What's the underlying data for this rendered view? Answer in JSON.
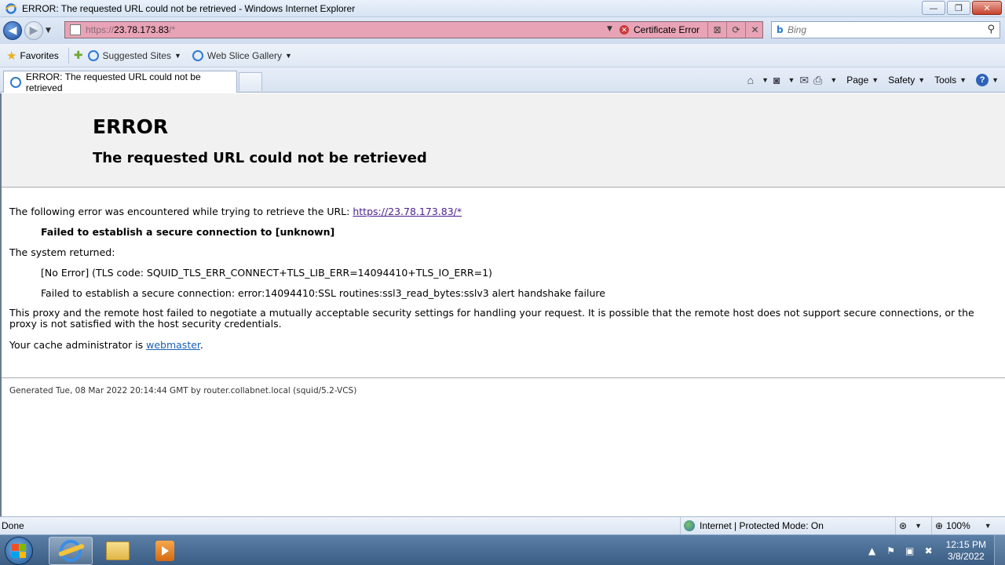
{
  "window": {
    "title": "ERROR: The requested URL could not be retrieved - Windows Internet Explorer",
    "controls": {
      "minimize": "—",
      "maximize": "❐",
      "close": "✕"
    }
  },
  "address": {
    "scheme": "https://",
    "host": "23.78.173.83",
    "path": "/*",
    "certificate_error": "Certificate Error",
    "color": "#e8a4b6"
  },
  "search": {
    "placeholder": "Bing"
  },
  "favorites_bar": {
    "favorites_label": "Favorites",
    "items": [
      {
        "label": "Suggested Sites"
      },
      {
        "label": "Web Slice Gallery"
      }
    ]
  },
  "tab": {
    "title": "ERROR: The requested URL could not be retrieved"
  },
  "command_bar": {
    "page": "Page",
    "safety": "Safety",
    "tools": "Tools"
  },
  "page": {
    "heading": "ERROR",
    "subheading": "The requested URL could not be retrieved",
    "intro": "The following error was encountered while trying to retrieve the URL: ",
    "url_link": "https://23.78.173.83/*",
    "failure": "Failed to establish a secure connection to [unknown]",
    "system_returned": "The system returned:",
    "tls_code": "[No Error] (TLS code: SQUID_TLS_ERR_CONNECT+TLS_LIB_ERR=14094410+TLS_IO_ERR=1)",
    "ssl_error": "Failed to establish a secure connection: error:14094410:SSL routines:ssl3_read_bytes:sslv3 alert handshake failure",
    "explanation_line1": "This proxy and the remote host failed to negotiate a mutually acceptable security settings for handling your request. It is possible that the remote host does not support secure connections, or the",
    "explanation_line2": "proxy is not satisfied with the host security credentials.",
    "admin_prefix": "Your cache administrator is ",
    "admin_link": "webmaster",
    "admin_suffix": ".",
    "generated": "Generated Tue, 08 Mar 2022 20:14:44 GMT by router.collabnet.local (squid/5.2-VCS)"
  },
  "status_bar": {
    "status": "Done",
    "zone": "Internet | Protected Mode: On",
    "zoom": "100%"
  },
  "taskbar": {
    "time": "12:15 PM",
    "date": "3/8/2022"
  }
}
